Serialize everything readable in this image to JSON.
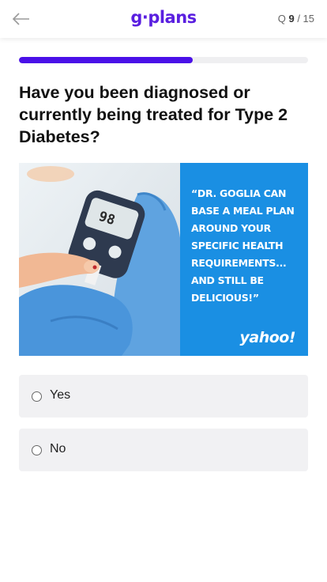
{
  "header": {
    "back_icon": "arrow-left-icon",
    "logo_text": "g·plans",
    "question_prefix": "Q",
    "question_current": "9",
    "question_total": "/ 15"
  },
  "progress": {
    "fraction": 0.6,
    "color": "#4a10e8"
  },
  "question": {
    "text": "Have you been diagnosed or currently being treated for Type 2 Diabetes?"
  },
  "hero": {
    "meter_reading": "98",
    "quote": "“DR. GOGLIA CAN BASE A MEAL PLAN AROUND YOUR SPECIFIC HEALTH REQUIREMENTS... AND STILL BE DELICIOUS!”",
    "source": "yahoo!",
    "accent_color": "#1a8fe3"
  },
  "options": [
    {
      "label": "Yes",
      "selected": false
    },
    {
      "label": "No",
      "selected": false
    }
  ],
  "colors": {
    "brand": "#5a1fe0",
    "option_bg": "#f1f1f3"
  }
}
